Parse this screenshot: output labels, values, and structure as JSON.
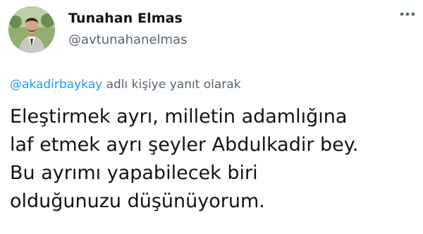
{
  "user": {
    "display_name": "Tunahan Elmas",
    "handle": "@avtunahanelmas",
    "avatar_icon": "profile-photo"
  },
  "reply": {
    "mention": "@akadirbaykay",
    "suffix": "adlı kişiye yanıt olarak"
  },
  "tweet": {
    "lines": [
      "Eleştirmek ayrı, milletin adamlığına",
      "laf etmek ayrı şeyler Abdulkadir bey.",
      "Bu ayrımı yapabilecek biri",
      "olduğunuzu düşünüyorum."
    ]
  },
  "icons": {
    "more": "more-options-icon"
  },
  "colors": {
    "text": "#0f1419",
    "secondary": "#536471",
    "link": "#1d9bf0"
  }
}
